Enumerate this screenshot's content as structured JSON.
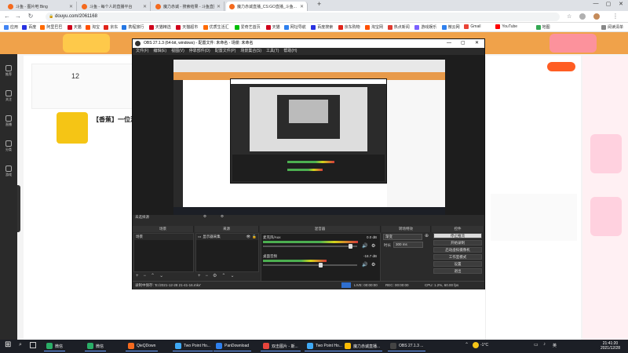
{
  "browser": {
    "tabs": [
      {
        "title": "斗鱼 - 图片吧 Bing",
        "color": "#f46a1e",
        "active": false
      },
      {
        "title": "斗鱼 - 每个人的直播平台",
        "color": "#f46a1e",
        "active": false
      },
      {
        "title": "魔力赤诚 - 搜索结果 - 斗鱼直播",
        "color": "#f46a1e",
        "active": false
      },
      {
        "title": "魔力赤诚直播_CS:GO直播_斗鱼...",
        "color": "#f46a1e",
        "active": true
      }
    ],
    "new_tab": "+",
    "window_controls": {
      "minimize": "—",
      "maximize": "▢",
      "close": "✕"
    },
    "nav": {
      "back": "←",
      "forward": "→",
      "reload": "↻"
    },
    "url": "douyu.com/2061168",
    "bookmarks": [
      {
        "label": "应用",
        "color": "#4285f4"
      },
      {
        "label": "百度",
        "color": "#2932e1"
      },
      {
        "label": "阿里巴巴",
        "color": "#ff6a00"
      },
      {
        "label": "天猫",
        "color": "#d0021b"
      },
      {
        "label": "淘宝",
        "color": "#ff5000"
      },
      {
        "label": "京东",
        "color": "#e1251b"
      },
      {
        "label": "携程旅行",
        "color": "#2577e3"
      },
      {
        "label": "天猫精选",
        "color": "#d0021b"
      },
      {
        "label": "天猫超市",
        "color": "#d0021b"
      },
      {
        "label": "优质生活汇",
        "color": "#ff6a00"
      },
      {
        "label": "爱奇艺首页",
        "color": "#00be06"
      },
      {
        "label": "天猫",
        "color": "#d0021b"
      },
      {
        "label": "网址导航",
        "color": "#2f80ed"
      },
      {
        "label": "百度搜索",
        "color": "#2932e1"
      },
      {
        "label": "京东购物",
        "color": "#e1251b"
      },
      {
        "label": "淘宝网",
        "color": "#ff5000"
      },
      {
        "label": "热点新闻",
        "color": "#e03c31"
      },
      {
        "label": "游戏娱乐",
        "color": "#7b61ff"
      },
      {
        "label": "微云网",
        "color": "#2f80ed"
      },
      {
        "label": "Gmail",
        "color": "#ea4335"
      },
      {
        "label": "YouTube",
        "color": "#ff0000"
      },
      {
        "label": "地图",
        "color": "#34a853"
      }
    ],
    "reading_list": "阅读清单"
  },
  "site": {
    "left_nav": [
      "推荐",
      "关注",
      "直播",
      "分类",
      "游戏"
    ],
    "streamer": {
      "title": "【香蕉】一位温...",
      "level": "12"
    }
  },
  "obs": {
    "title": "OBS 27.1.3 (64-bit, windows) - 配置文件: 未命名 - 场景: 未命名",
    "menu": [
      "文件(F)",
      "编辑(E)",
      "视图(V)",
      "停靠部件(D)",
      "配置文件(P)",
      "场景集合(S)",
      "工具(T)",
      "帮助(H)"
    ],
    "no_source": "未选择源",
    "docks": {
      "scenes": "场景",
      "sources": "来源",
      "mixer": "混音器",
      "transitions": "转场特效",
      "controls": "控件"
    },
    "scene_item": "场景",
    "source_item": "显示器采集",
    "mixer": [
      {
        "name": "麦克风/Aux",
        "db": "0.0 dB",
        "level": 0.93
      },
      {
        "name": "桌面音频",
        "db": "-18.7 dB",
        "level": 0.62
      }
    ],
    "transition": {
      "value": "渐变",
      "duration_label": "时长",
      "duration": "300 ms"
    },
    "controls": [
      "停止推流",
      "开始录制",
      "启动虚拟摄像机",
      "工作室模式",
      "设置",
      "退出"
    ],
    "status": {
      "recording": "录制中保存: 'E:/2021-12-28 21-41-16.mkv'",
      "live": "LIVE: 00:00:00",
      "rec": "REC: 00:00:00",
      "cpu": "CPU: 1.2%, 60.00 fps"
    }
  },
  "taskbar": {
    "start": "⊞",
    "items": [
      {
        "label": "微信",
        "color": "#2aae67"
      },
      {
        "label": "微信",
        "color": "#2aae67"
      },
      {
        "label": "QieQDown",
        "color": "#f46a1e"
      },
      {
        "label": "Two Point Ho...",
        "color": "#3fa9f5"
      },
      {
        "label": "PanDownload",
        "color": "#2f80ed"
      },
      {
        "label": "双击图片 - 斯...",
        "color": "#e8453c"
      },
      {
        "label": "Two Point Ho...",
        "color": "#3fa9f5"
      },
      {
        "label": "魔力赤诚直播...",
        "color": "#fbbc05"
      },
      {
        "label": "OBS 27.1.3 ...",
        "color": "#444444"
      }
    ],
    "temperature": "-1°C",
    "ime": "英",
    "time": "21:41:20",
    "date": "2021/12/28"
  }
}
